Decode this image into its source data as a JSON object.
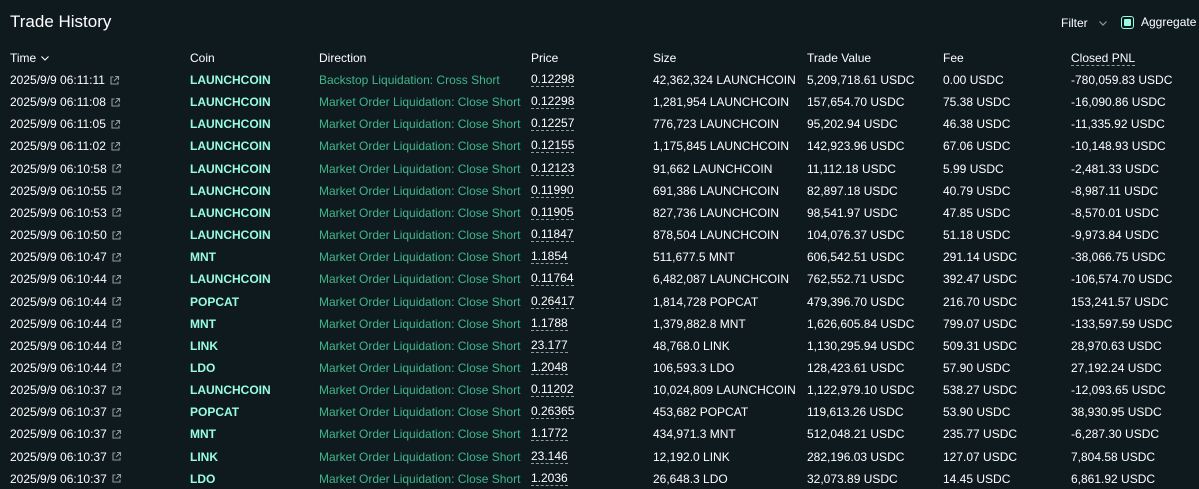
{
  "header": {
    "title": "Trade History",
    "filter_label": "Filter",
    "aggregate_label": "Aggregate",
    "aggregate_checked": true
  },
  "columns": {
    "time": "Time",
    "coin": "Coin",
    "direction": "Direction",
    "price": "Price",
    "size": "Size",
    "trade_value": "Trade Value",
    "fee": "Fee",
    "closed_pnl": "Closed PNL"
  },
  "colors": {
    "background": "#0f1a1f",
    "coin": "#97fce4",
    "direction": "#3fb68b",
    "text": "#ffffff"
  },
  "rows": [
    {
      "time": "2025/9/9 06:11:11",
      "coin": "LAUNCHCOIN",
      "direction": "Backstop Liquidation: Cross Short",
      "price": "0.12298",
      "size": "42,362,324 LAUNCHCOIN",
      "trade_value": "5,209,718.61 USDC",
      "fee": "0.00 USDC",
      "closed_pnl": "-780,059.83 USDC"
    },
    {
      "time": "2025/9/9 06:11:08",
      "coin": "LAUNCHCOIN",
      "direction": "Market Order Liquidation: Close Short",
      "price": "0.12298",
      "size": "1,281,954 LAUNCHCOIN",
      "trade_value": "157,654.70 USDC",
      "fee": "75.38 USDC",
      "closed_pnl": "-16,090.86 USDC"
    },
    {
      "time": "2025/9/9 06:11:05",
      "coin": "LAUNCHCOIN",
      "direction": "Market Order Liquidation: Close Short",
      "price": "0.12257",
      "size": "776,723 LAUNCHCOIN",
      "trade_value": "95,202.94 USDC",
      "fee": "46.38 USDC",
      "closed_pnl": "-11,335.92 USDC"
    },
    {
      "time": "2025/9/9 06:11:02",
      "coin": "LAUNCHCOIN",
      "direction": "Market Order Liquidation: Close Short",
      "price": "0.12155",
      "size": "1,175,845 LAUNCHCOIN",
      "trade_value": "142,923.96 USDC",
      "fee": "67.06 USDC",
      "closed_pnl": "-10,148.93 USDC"
    },
    {
      "time": "2025/9/9 06:10:58",
      "coin": "LAUNCHCOIN",
      "direction": "Market Order Liquidation: Close Short",
      "price": "0.12123",
      "size": "91,662 LAUNCHCOIN",
      "trade_value": "11,112.18 USDC",
      "fee": "5.99 USDC",
      "closed_pnl": "-2,481.33 USDC"
    },
    {
      "time": "2025/9/9 06:10:55",
      "coin": "LAUNCHCOIN",
      "direction": "Market Order Liquidation: Close Short",
      "price": "0.11990",
      "size": "691,386 LAUNCHCOIN",
      "trade_value": "82,897.18 USDC",
      "fee": "40.79 USDC",
      "closed_pnl": "-8,987.11 USDC"
    },
    {
      "time": "2025/9/9 06:10:53",
      "coin": "LAUNCHCOIN",
      "direction": "Market Order Liquidation: Close Short",
      "price": "0.11905",
      "size": "827,736 LAUNCHCOIN",
      "trade_value": "98,541.97 USDC",
      "fee": "47.85 USDC",
      "closed_pnl": "-8,570.01 USDC"
    },
    {
      "time": "2025/9/9 06:10:50",
      "coin": "LAUNCHCOIN",
      "direction": "Market Order Liquidation: Close Short",
      "price": "0.11847",
      "size": "878,504 LAUNCHCOIN",
      "trade_value": "104,076.37 USDC",
      "fee": "51.18 USDC",
      "closed_pnl": "-9,973.84 USDC"
    },
    {
      "time": "2025/9/9 06:10:47",
      "coin": "MNT",
      "direction": "Market Order Liquidation: Close Short",
      "price": "1.1854",
      "size": "511,677.5 MNT",
      "trade_value": "606,542.51 USDC",
      "fee": "291.14 USDC",
      "closed_pnl": "-38,066.75 USDC"
    },
    {
      "time": "2025/9/9 06:10:44",
      "coin": "LAUNCHCOIN",
      "direction": "Market Order Liquidation: Close Short",
      "price": "0.11764",
      "size": "6,482,087 LAUNCHCOIN",
      "trade_value": "762,552.71 USDC",
      "fee": "392.47 USDC",
      "closed_pnl": "-106,574.70 USDC"
    },
    {
      "time": "2025/9/9 06:10:44",
      "coin": "POPCAT",
      "direction": "Market Order Liquidation: Close Short",
      "price": "0.26417",
      "size": "1,814,728 POPCAT",
      "trade_value": "479,396.70 USDC",
      "fee": "216.70 USDC",
      "closed_pnl": "153,241.57 USDC"
    },
    {
      "time": "2025/9/9 06:10:44",
      "coin": "MNT",
      "direction": "Market Order Liquidation: Close Short",
      "price": "1.1788",
      "size": "1,379,882.8 MNT",
      "trade_value": "1,626,605.84 USDC",
      "fee": "799.07 USDC",
      "closed_pnl": "-133,597.59 USDC"
    },
    {
      "time": "2025/9/9 06:10:44",
      "coin": "LINK",
      "direction": "Market Order Liquidation: Close Short",
      "price": "23.177",
      "size": "48,768.0 LINK",
      "trade_value": "1,130,295.94 USDC",
      "fee": "509.31 USDC",
      "closed_pnl": "28,970.63 USDC"
    },
    {
      "time": "2025/9/9 06:10:44",
      "coin": "LDO",
      "direction": "Market Order Liquidation: Close Short",
      "price": "1.2048",
      "size": "106,593.3 LDO",
      "trade_value": "128,423.61 USDC",
      "fee": "57.90 USDC",
      "closed_pnl": "27,192.24 USDC"
    },
    {
      "time": "2025/9/9 06:10:37",
      "coin": "LAUNCHCOIN",
      "direction": "Market Order Liquidation: Close Short",
      "price": "0.11202",
      "size": "10,024,809 LAUNCHCOIN",
      "trade_value": "1,122,979.10 USDC",
      "fee": "538.27 USDC",
      "closed_pnl": "-12,093.65 USDC"
    },
    {
      "time": "2025/9/9 06:10:37",
      "coin": "POPCAT",
      "direction": "Market Order Liquidation: Close Short",
      "price": "0.26365",
      "size": "453,682 POPCAT",
      "trade_value": "119,613.26 USDC",
      "fee": "53.90 USDC",
      "closed_pnl": "38,930.95 USDC"
    },
    {
      "time": "2025/9/9 06:10:37",
      "coin": "MNT",
      "direction": "Market Order Liquidation: Close Short",
      "price": "1.1772",
      "size": "434,971.3 MNT",
      "trade_value": "512,048.21 USDC",
      "fee": "235.77 USDC",
      "closed_pnl": "-6,287.30 USDC"
    },
    {
      "time": "2025/9/9 06:10:37",
      "coin": "LINK",
      "direction": "Market Order Liquidation: Close Short",
      "price": "23.146",
      "size": "12,192.0 LINK",
      "trade_value": "282,196.03 USDC",
      "fee": "127.07 USDC",
      "closed_pnl": "7,804.58 USDC"
    },
    {
      "time": "2025/9/9 06:10:37",
      "coin": "LDO",
      "direction": "Market Order Liquidation: Close Short",
      "price": "1.2036",
      "size": "26,648.3 LDO",
      "trade_value": "32,073.89 USDC",
      "fee": "14.45 USDC",
      "closed_pnl": "6,861.92 USDC"
    }
  ]
}
